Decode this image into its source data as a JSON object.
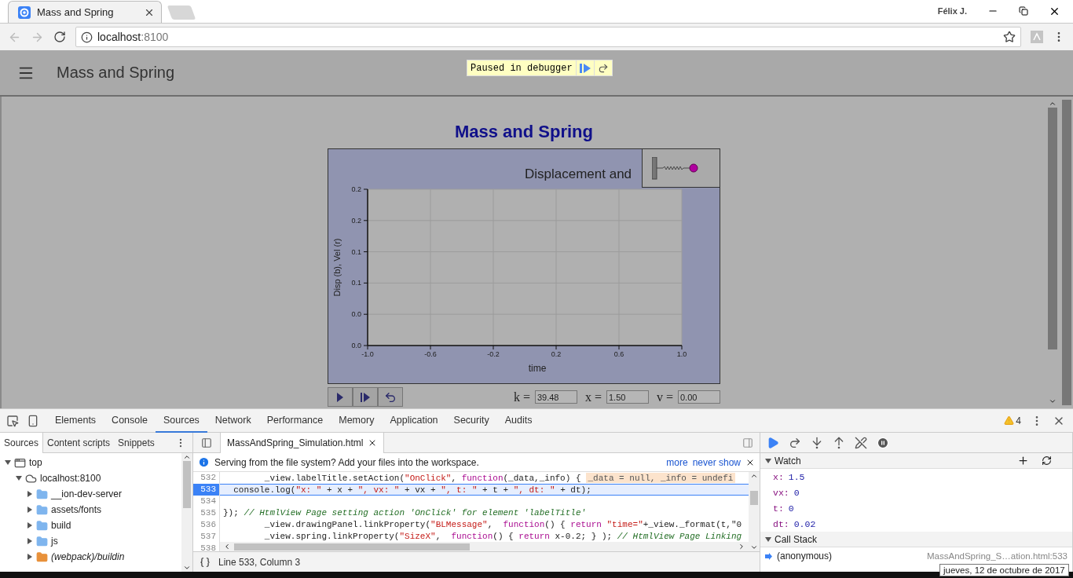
{
  "browser": {
    "tab": {
      "title": "Mass and Spring",
      "selected": true
    },
    "profile": "Félix J.",
    "address": {
      "host": "localhost",
      "port": ":8100"
    }
  },
  "app": {
    "title": "Mass and Spring",
    "debugger_banner": "Paused in debugger"
  },
  "simulation": {
    "title": "Mass and Spring",
    "chart_data": {
      "type": "line",
      "grid": true,
      "title": "Displacement and",
      "xlabel": "time",
      "ylabel": "Disp (b), Vel (r)",
      "xlim": [
        -1,
        1
      ],
      "ylim": [
        0,
        0.2
      ],
      "xticks": [
        {
          "value": -1,
          "label": "-1.0"
        },
        {
          "value": -0.6,
          "label": "-0.6"
        },
        {
          "value": -0.2,
          "label": "-0.2"
        },
        {
          "value": 0.2,
          "label": "0.2"
        },
        {
          "value": 0.6,
          "label": "0.6"
        },
        {
          "value": 1,
          "label": "1.0"
        }
      ],
      "yticks": [
        {
          "value": 0,
          "label": "0.0"
        },
        {
          "value": 0.04,
          "label": "0.0"
        },
        {
          "value": 0.08,
          "label": "0.1"
        },
        {
          "value": 0.12,
          "label": "0.1"
        },
        {
          "value": 0.16,
          "label": "0.2"
        },
        {
          "value": 0.2,
          "label": "0.2"
        }
      ]
    },
    "fields": [
      {
        "label": "k =",
        "value": "39.48"
      },
      {
        "label": "x =",
        "value": "1.50"
      },
      {
        "label": "v =",
        "value": "0.00"
      }
    ]
  },
  "devtools": {
    "tabs": [
      {
        "label": "Elements",
        "selected": false
      },
      {
        "label": "Console",
        "selected": false
      },
      {
        "label": "Sources",
        "selected": true
      },
      {
        "label": "Network",
        "selected": false
      },
      {
        "label": "Performance",
        "selected": false
      },
      {
        "label": "Memory",
        "selected": false
      },
      {
        "label": "Application",
        "selected": false
      },
      {
        "label": "Security",
        "selected": false
      },
      {
        "label": "Audits",
        "selected": false
      }
    ],
    "warnings": "4",
    "navigator": {
      "tabs": [
        {
          "label": "Sources",
          "selected": true
        },
        {
          "label": "Content scripts",
          "selected": false
        },
        {
          "label": "Snippets",
          "selected": false
        }
      ],
      "tree": [
        {
          "label": "top",
          "kind": "frame",
          "expanded": true,
          "children": [
            {
              "label": "localhost:8100",
              "kind": "host",
              "expanded": true,
              "children": [
                {
                  "label": "__ion-dev-server",
                  "kind": "folder",
                  "expanded": false
                },
                {
                  "label": "assets/fonts",
                  "kind": "folder",
                  "expanded": false
                },
                {
                  "label": "build",
                  "kind": "folder",
                  "expanded": false
                },
                {
                  "label": "js",
                  "kind": "folder",
                  "expanded": false
                },
                {
                  "label": "(webpack)/buildin",
                  "kind": "webpack",
                  "expanded": false
                }
              ]
            }
          ]
        }
      ]
    },
    "editor": {
      "file_tab": "MassAndSpring_Simulation.html",
      "info": "Serving from the file system? Add your files into the workspace.",
      "links": [
        "more",
        "never show"
      ],
      "lines": [
        {
          "number": "532",
          "current": false,
          "segments": [
            {
              "kind": "plain",
              "text": "        _view.labelTitle.setAction("
            },
            {
              "kind": "string",
              "text": "\"OnClick\""
            },
            {
              "kind": "plain",
              "text": ", "
            },
            {
              "kind": "keyword",
              "text": "function"
            },
            {
              "kind": "plain",
              "text": "(_data,_info) {"
            }
          ],
          "inline_value": "_data = null, _info = undefi"
        },
        {
          "number": "533",
          "current": true,
          "segments": [
            {
              "kind": "plain",
              "text": "  console.log("
            },
            {
              "kind": "string",
              "text": "\"x: \""
            },
            {
              "kind": "plain",
              "text": " + x + "
            },
            {
              "kind": "string",
              "text": "\", vx: \""
            },
            {
              "kind": "plain",
              "text": " + vx + "
            },
            {
              "kind": "string",
              "text": "\", t: \""
            },
            {
              "kind": "plain",
              "text": " + t + "
            },
            {
              "kind": "string",
              "text": "\", dt: \""
            },
            {
              "kind": "plain",
              "text": " + dt);"
            }
          ]
        },
        {
          "number": "534",
          "current": false
        },
        {
          "number": "535",
          "current": false,
          "segments": [
            {
              "kind": "plain",
              "text": "}); "
            },
            {
              "kind": "comment",
              "text": "// HtmlView Page setting action 'OnClick' for element 'labelTitle'"
            }
          ]
        },
        {
          "number": "536",
          "current": false,
          "segments": [
            {
              "kind": "plain",
              "text": "        _view.drawingPanel.linkProperty("
            },
            {
              "kind": "string",
              "text": "\"BLMessage\""
            },
            {
              "kind": "plain",
              "text": ",  "
            },
            {
              "kind": "keyword",
              "text": "function"
            },
            {
              "kind": "plain",
              "text": "() { "
            },
            {
              "kind": "keyword",
              "text": "return"
            },
            {
              "kind": "string",
              "text": " \"time=\""
            },
            {
              "kind": "plain",
              "text": "+_view._format(t,\"0"
            }
          ]
        },
        {
          "number": "537",
          "current": false,
          "segments": [
            {
              "kind": "plain",
              "text": "        _view.spring.linkProperty("
            },
            {
              "kind": "string",
              "text": "\"SizeX\""
            },
            {
              "kind": "plain",
              "text": ",  "
            },
            {
              "kind": "keyword",
              "text": "function"
            },
            {
              "kind": "plain",
              "text": "() { "
            },
            {
              "kind": "keyword",
              "text": "return"
            },
            {
              "kind": "plain",
              "text": " x-0.2; } ); "
            },
            {
              "kind": "comment",
              "text": "// HtmlView Page Linking"
            }
          ]
        },
        {
          "number": "538",
          "current": false
        }
      ],
      "status": "Line 533, Column 3"
    },
    "watch": {
      "title": "Watch",
      "items": [
        {
          "name": "x:",
          "value": "1.5"
        },
        {
          "name": "vx:",
          "value": "0"
        },
        {
          "name": "t:",
          "value": "0"
        },
        {
          "name": "dt:",
          "value": "0.02"
        }
      ]
    },
    "call_stack": {
      "title": "Call Stack",
      "frames": [
        {
          "name": "(anonymous)",
          "location": "MassAndSpring_S…ation.html:533",
          "current": true
        }
      ]
    }
  },
  "tooltip": "jueves, 12 de octubre de 2017"
}
